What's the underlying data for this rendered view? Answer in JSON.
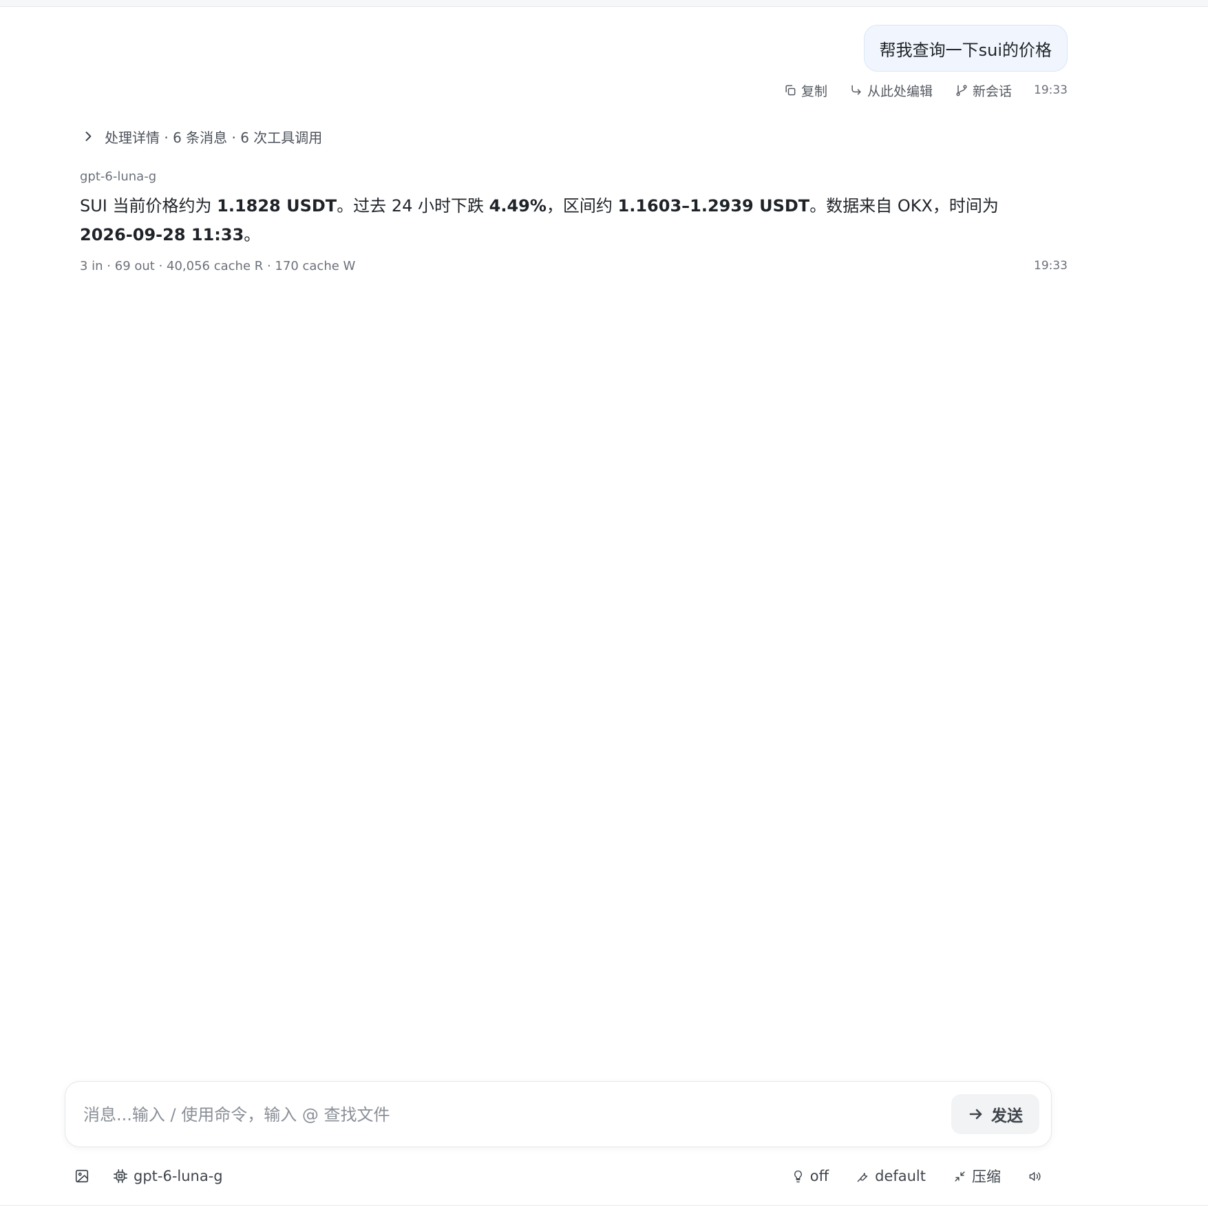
{
  "user_message": {
    "text": "帮我查询一下sui的价格",
    "actions": {
      "copy": "复制",
      "edit_from_here": "从此处编辑",
      "new_chat": "新会话"
    },
    "time": "19:33"
  },
  "details": {
    "label": "处理详情 · 6 条消息 · 6 次工具调用"
  },
  "assistant": {
    "model": "gpt-6-luna-g",
    "segments": [
      {
        "text": "SUI 当前价格约为 ",
        "bold": false
      },
      {
        "text": "1.1828 USDT",
        "bold": true
      },
      {
        "text": "。过去 24 小时下跌 ",
        "bold": false
      },
      {
        "text": "4.49%",
        "bold": true
      },
      {
        "text": "，区间约 ",
        "bold": false
      },
      {
        "text": "1.1603–1.2939 USDT",
        "bold": true
      },
      {
        "text": "。数据来自 OKX，时间为 ",
        "bold": false
      },
      {
        "text": "2026-09-28 11:33",
        "bold": true
      },
      {
        "text": "。",
        "bold": false
      }
    ],
    "usage": "3 in · 69 out · 40,056 cache R · 170 cache W",
    "time": "19:33"
  },
  "composer": {
    "placeholder": "消息...输入 / 使用命令，输入 @ 查找文件",
    "send_label": "发送"
  },
  "toolbar": {
    "model": "gpt-6-luna-g",
    "thinking": "off",
    "permission": "default",
    "compress": "压缩"
  },
  "icons": {
    "copy": "copy-icon",
    "edit": "corner-down-right-icon",
    "branch": "git-branch-icon",
    "chevron": "chevron-right-icon",
    "send": "arrow-right-icon",
    "image": "image-icon",
    "chip": "cpu-icon",
    "bulb": "lightbulb-icon",
    "wrench": "wrench-icon",
    "minimize": "minimize-icon",
    "volume": "volume-icon"
  }
}
